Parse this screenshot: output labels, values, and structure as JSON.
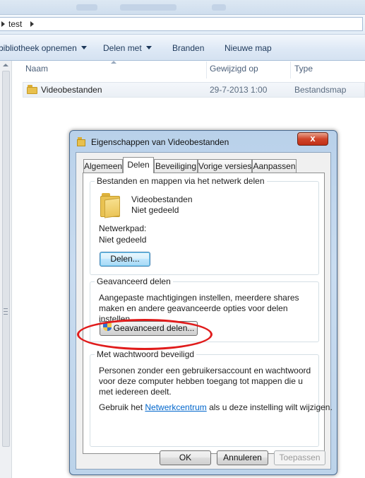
{
  "address": {
    "crumb": "test"
  },
  "toolbar": {
    "library": "bibliotheek opnemen",
    "share": "Delen met",
    "burn": "Branden",
    "new_folder": "Nieuwe map"
  },
  "columns": {
    "name": "Naam",
    "modified": "Gewijzigd op",
    "type": "Type"
  },
  "files": [
    {
      "name": "Videobestanden",
      "modified": "29-7-2013 1:00",
      "type": "Bestandsmap"
    }
  ],
  "dialog": {
    "title": "Eigenschappen van Videobestanden",
    "close": "x",
    "tabs": [
      "Algemeen",
      "Delen",
      "Beveiliging",
      "Vorige versies",
      "Aanpassen"
    ],
    "active_tab": "Delen",
    "network_group": {
      "title": "Bestanden en mappen via het netwerk delen",
      "folder_name": "Videobestanden",
      "folder_status": "Niet gedeeld",
      "path_label": "Netwerkpad:",
      "path_value": "Niet gedeeld",
      "share_button": "Delen..."
    },
    "advanced_group": {
      "title": "Geavanceerd delen",
      "description": "Aangepaste machtigingen instellen, meerdere shares maken en andere geavanceerde opties voor delen instellen.",
      "button": "Geavanceerd delen..."
    },
    "password_group": {
      "title": "Met wachtwoord beveiligd",
      "description": "Personen zonder een gebruikersaccount en wachtwoord voor deze computer hebben toegang tot mappen die u met iedereen deelt.",
      "change_prefix": "Gebruik het ",
      "change_link": "Netwerkcentrum",
      "change_suffix": " als u deze instelling wilt wijzigen."
    },
    "buttons": {
      "ok": "OK",
      "cancel": "Annuleren",
      "apply": "Toepassen"
    }
  },
  "colors": {
    "annotation": "#e01b1b",
    "link": "#0066cc"
  }
}
